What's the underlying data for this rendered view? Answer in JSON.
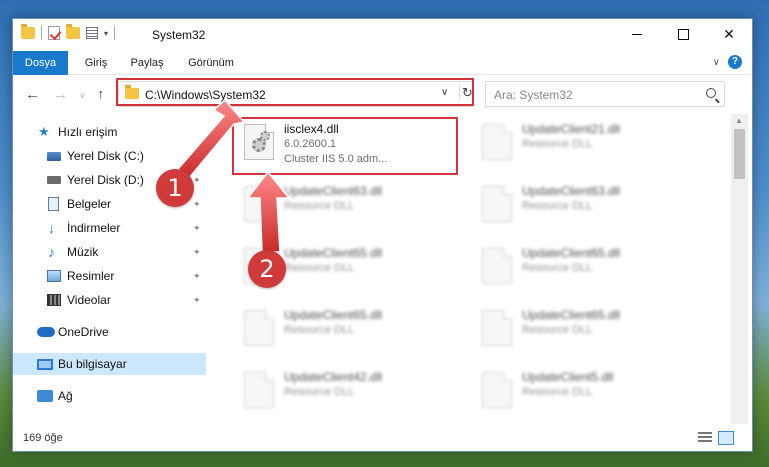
{
  "window": {
    "title": "System32",
    "controls": {
      "minimize": "",
      "maximize": "",
      "close": "✕"
    }
  },
  "ribbon": {
    "tabs": [
      "Dosya",
      "Giriş",
      "Paylaş",
      "Görünüm"
    ],
    "help": "?"
  },
  "nav": {
    "address": "C:\\Windows\\System32",
    "search_placeholder": "Ara: System32"
  },
  "sidebar": {
    "items": [
      {
        "label": "Hızlı erişim",
        "icon": "star-icon",
        "pinned": false
      },
      {
        "label": "Yerel Disk (C:)",
        "icon": "disk-icon",
        "pinned": true
      },
      {
        "label": "Yerel Disk (D:)",
        "icon": "disk-icon",
        "pinned": true
      },
      {
        "label": "Belgeler",
        "icon": "documents-icon",
        "pinned": true
      },
      {
        "label": "İndirmeler",
        "icon": "downloads-icon",
        "pinned": true
      },
      {
        "label": "Müzik",
        "icon": "music-icon",
        "pinned": true
      },
      {
        "label": "Resimler",
        "icon": "pictures-icon",
        "pinned": true
      },
      {
        "label": "Videolar",
        "icon": "videos-icon",
        "pinned": true
      },
      {
        "label": "OneDrive",
        "icon": "onedrive-icon",
        "pinned": false
      },
      {
        "label": "Bu bilgisayar",
        "icon": "this-pc-icon",
        "pinned": false,
        "selected": true
      },
      {
        "label": "Ağ",
        "icon": "network-icon",
        "pinned": false
      }
    ]
  },
  "files": [
    {
      "name": "iisclex4.dll",
      "line2": "6.0.2600.1",
      "line3": "Cluster IIS 5.0 adm..."
    },
    {
      "name": "UpdateClient21.dll",
      "line2": "Resource DLL"
    },
    {
      "name": "UpdateClient63.dll",
      "line2": "Resource DLL"
    },
    {
      "name": "UpdateClient63.dll",
      "line2": "Resource DLL"
    },
    {
      "name": "UpdateClient65.dll",
      "line2": "Resource DLL"
    },
    {
      "name": "UpdateClient65.dll",
      "line2": "Resource DLL"
    },
    {
      "name": "UpdateClient65.dll",
      "line2": "Resource DLL"
    },
    {
      "name": "UpdateClient65.dll",
      "line2": "Resource DLL"
    },
    {
      "name": "UpdateClient42.dll",
      "line2": "Resource DLL"
    },
    {
      "name": "UpdateClient5.dll",
      "line2": "Resource DLL"
    }
  ],
  "status": {
    "count": "169 öğe"
  },
  "callouts": [
    "1",
    "2"
  ],
  "colors": {
    "accent": "#1979ca",
    "highlight": "#d6323a",
    "selected": "#cce8ff"
  }
}
